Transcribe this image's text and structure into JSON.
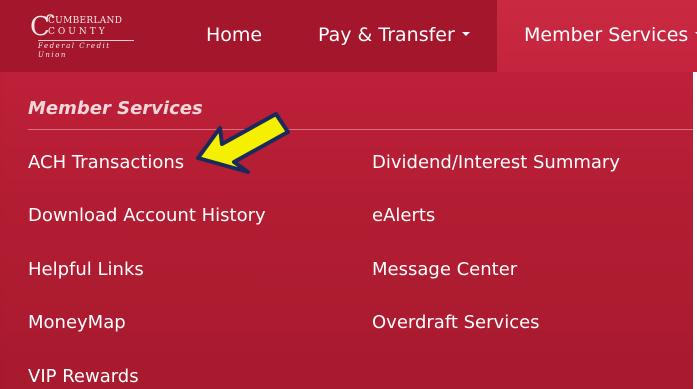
{
  "logo": {
    "line1": "CUMBERLAND",
    "line2": "COUNTY",
    "line3": "Federal Credit Union",
    "icon": "swoosh-c-glyph"
  },
  "nav": {
    "home": "Home",
    "pay_transfer": "Pay & Transfer",
    "member_services": "Member Services"
  },
  "dropdown": {
    "heading": "Member Services",
    "col1": [
      "ACH Transactions",
      "Download Account History",
      "Helpful Links",
      "MoneyMap",
      "VIP Rewards"
    ],
    "col2": [
      "Dividend/Interest Summary",
      "eAlerts",
      "Message Center",
      "Overdraft Services"
    ]
  },
  "annotation": {
    "arrow_color": "#f5f000",
    "arrow_outline": "#1b2a5c"
  },
  "colors": {
    "brand_red": "#b51d33",
    "nav_dark": "#a3162b",
    "text": "#ffffff"
  }
}
